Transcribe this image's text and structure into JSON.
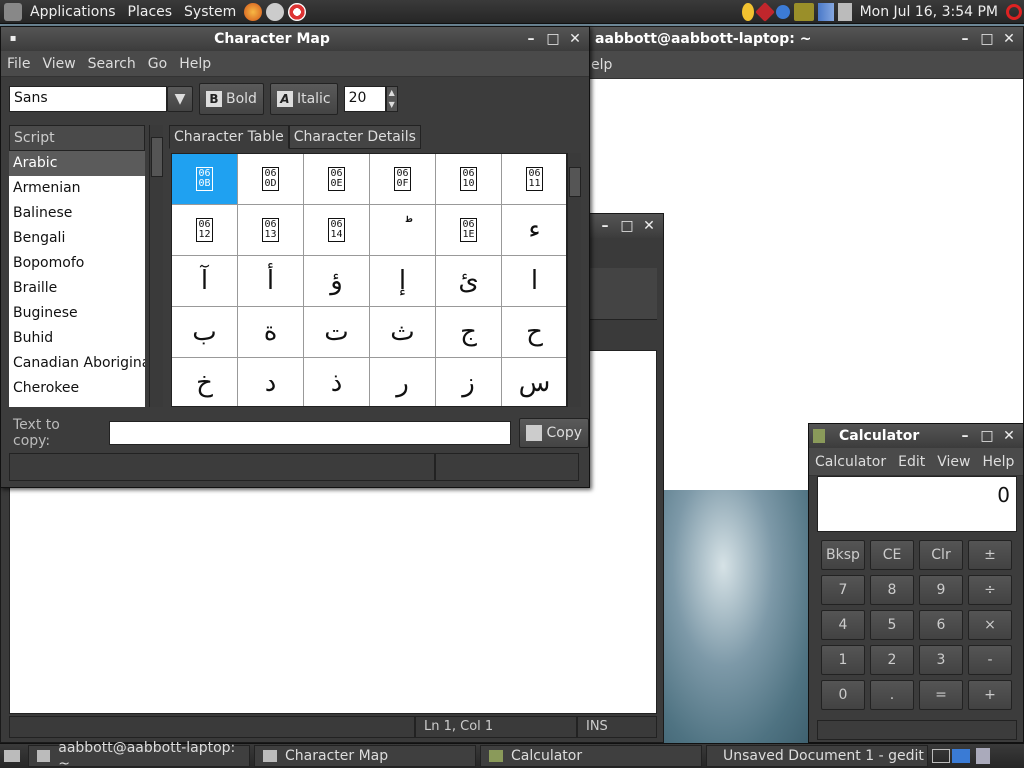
{
  "top_panel": {
    "menus": [
      "Applications",
      "Places",
      "System"
    ],
    "clock": "Mon Jul 16,  3:54 PM"
  },
  "terminal": {
    "title": "aabbott@aabbott-laptop: ~",
    "menu_fragment": "elp"
  },
  "charmap": {
    "title": "Character Map",
    "menu": [
      "File",
      "View",
      "Search",
      "Go",
      "Help"
    ],
    "font_value": "Sans",
    "bold_label": "Bold",
    "italic_label": "Italic",
    "size_value": "20",
    "script_header": "Script",
    "scripts": [
      "Arabic",
      "Armenian",
      "Balinese",
      "Bengali",
      "Bopomofo",
      "Braille",
      "Buginese",
      "Buhid",
      "Canadian Aboriginal",
      "Cherokee"
    ],
    "selected_script": "Arabic",
    "tabs": [
      "Character Table",
      "Character Details"
    ],
    "characters": [
      [
        "060B",
        "060D",
        "060E",
        "060F",
        "0610",
        "0611"
      ],
      [
        "0612",
        "0613",
        "0614",
        "ؕ",
        "061E",
        "ء"
      ],
      [
        "آ",
        "أ",
        "ؤ",
        "إ",
        "ئ",
        "ا"
      ],
      [
        "ب",
        "ة",
        "ت",
        "ث",
        "ج",
        "ح"
      ],
      [
        "خ",
        "د",
        "ذ",
        "ر",
        "ز",
        "س"
      ]
    ],
    "copy_label": "Text to copy:",
    "copy_value": "",
    "copy_button": "Copy"
  },
  "gedit": {
    "status_position": "Ln 1, Col 1",
    "status_mode": "INS"
  },
  "calculator": {
    "title": "Calculator",
    "menu": [
      "Calculator",
      "Edit",
      "View",
      "Help"
    ],
    "display": "0",
    "buttons": [
      [
        "Bksp",
        "CE",
        "Clr",
        "±"
      ],
      [
        "7",
        "8",
        "9",
        "÷"
      ],
      [
        "4",
        "5",
        "6",
        "×"
      ],
      [
        "1",
        "2",
        "3",
        "-"
      ],
      [
        "0",
        ".",
        "=",
        "+"
      ]
    ]
  },
  "taskbar": {
    "tasks": [
      "aabbott@aabbott-laptop: ~",
      "Character Map",
      "Calculator",
      "Unsaved Document 1 - gedit"
    ]
  }
}
